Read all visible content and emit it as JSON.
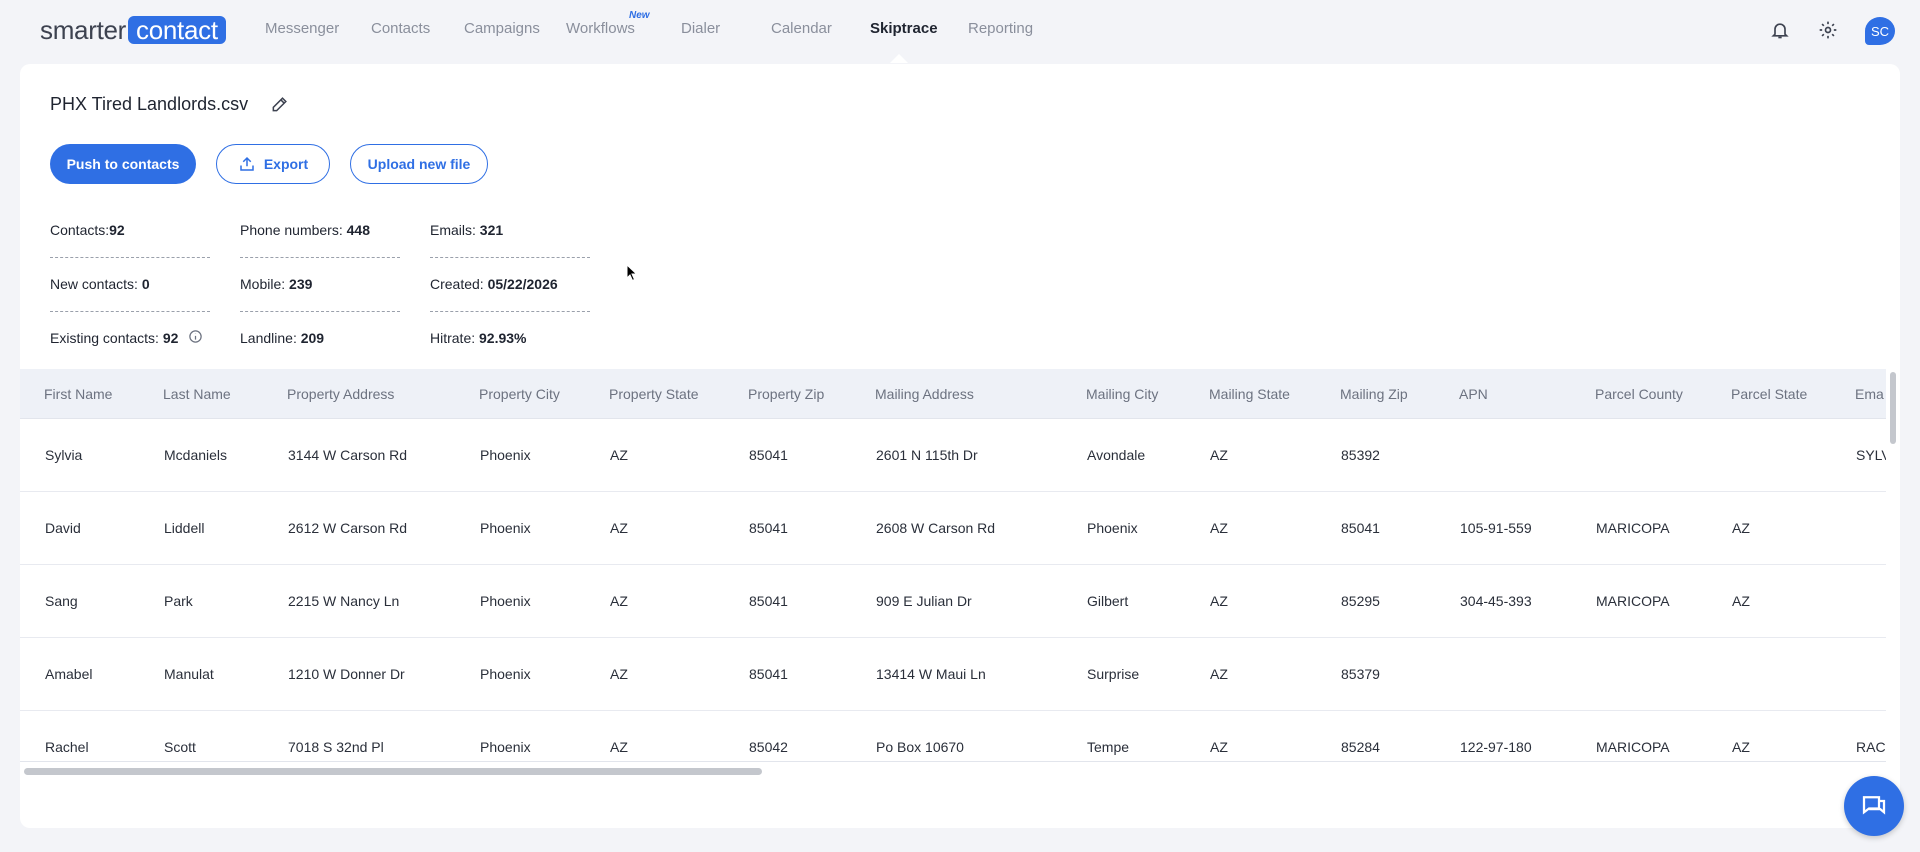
{
  "logo": {
    "part1": "smarter",
    "part2": "contact"
  },
  "nav": {
    "items": [
      "Messenger",
      "Contacts",
      "Campaigns",
      "Workflows",
      "Dialer",
      "Calendar",
      "Skiptrace",
      "Reporting"
    ],
    "active": "Skiptrace",
    "new_badge": "New"
  },
  "user": {
    "initials": "SC"
  },
  "file": {
    "title": "PHX Tired Landlords.csv"
  },
  "actions": {
    "push": "Push to contacts",
    "export": "Export",
    "upload": "Upload new file"
  },
  "stats": {
    "contacts_label": "Contacts:",
    "contacts_value": "92",
    "phone_label": "Phone numbers: ",
    "phone_value": "448",
    "emails_label": "Emails: ",
    "emails_value": "321",
    "new_label": "New contacts: ",
    "new_value": "0",
    "mobile_label": "Mobile: ",
    "mobile_value": "239",
    "created_label": "Created: ",
    "created_value": "05/22/2026",
    "existing_label": "Existing contacts: ",
    "existing_value": "92",
    "landline_label": "Landline: ",
    "landline_value": "209",
    "hitrate_label": "Hitrate: ",
    "hitrate_value": "92.93%"
  },
  "table": {
    "headers": [
      "First Name",
      "Last Name",
      "Property Address",
      "Property City",
      "Property State",
      "Property Zip",
      "Mailing Address",
      "Mailing City",
      "Mailing State",
      "Mailing Zip",
      "APN",
      "Parcel County",
      "Parcel State",
      "Ema"
    ],
    "rows": [
      [
        "Sylvia",
        "Mcdaniels",
        "3144 W Carson Rd",
        "Phoenix",
        "AZ",
        "85041",
        "2601 N 115th Dr",
        "Avondale",
        "AZ",
        "85392",
        "",
        "",
        "",
        "SYLV"
      ],
      [
        "David",
        "Liddell",
        "2612 W Carson Rd",
        "Phoenix",
        "AZ",
        "85041",
        "2608 W Carson Rd",
        "Phoenix",
        "AZ",
        "85041",
        "105-91-559",
        "MARICOPA",
        "AZ",
        ""
      ],
      [
        "Sang",
        "Park",
        "2215 W Nancy Ln",
        "Phoenix",
        "AZ",
        "85041",
        "909 E Julian Dr",
        "Gilbert",
        "AZ",
        "85295",
        "304-45-393",
        "MARICOPA",
        "AZ",
        ""
      ],
      [
        "Amabel",
        "Manulat",
        "1210 W Donner Dr",
        "Phoenix",
        "AZ",
        "85041",
        "13414 W Maui Ln",
        "Surprise",
        "AZ",
        "85379",
        "",
        "",
        "",
        ""
      ],
      [
        "Rachel",
        "Scott",
        "7018 S 32nd Pl",
        "Phoenix",
        "AZ",
        "85042",
        "Po Box 10670",
        "Tempe",
        "AZ",
        "85284",
        "122-97-180",
        "MARICOPA",
        "AZ",
        "RAC"
      ]
    ]
  },
  "colors": {
    "accent": "#2f6fe4",
    "header_bg": "#eef1f7",
    "page_bg": "#f3f4f8"
  }
}
